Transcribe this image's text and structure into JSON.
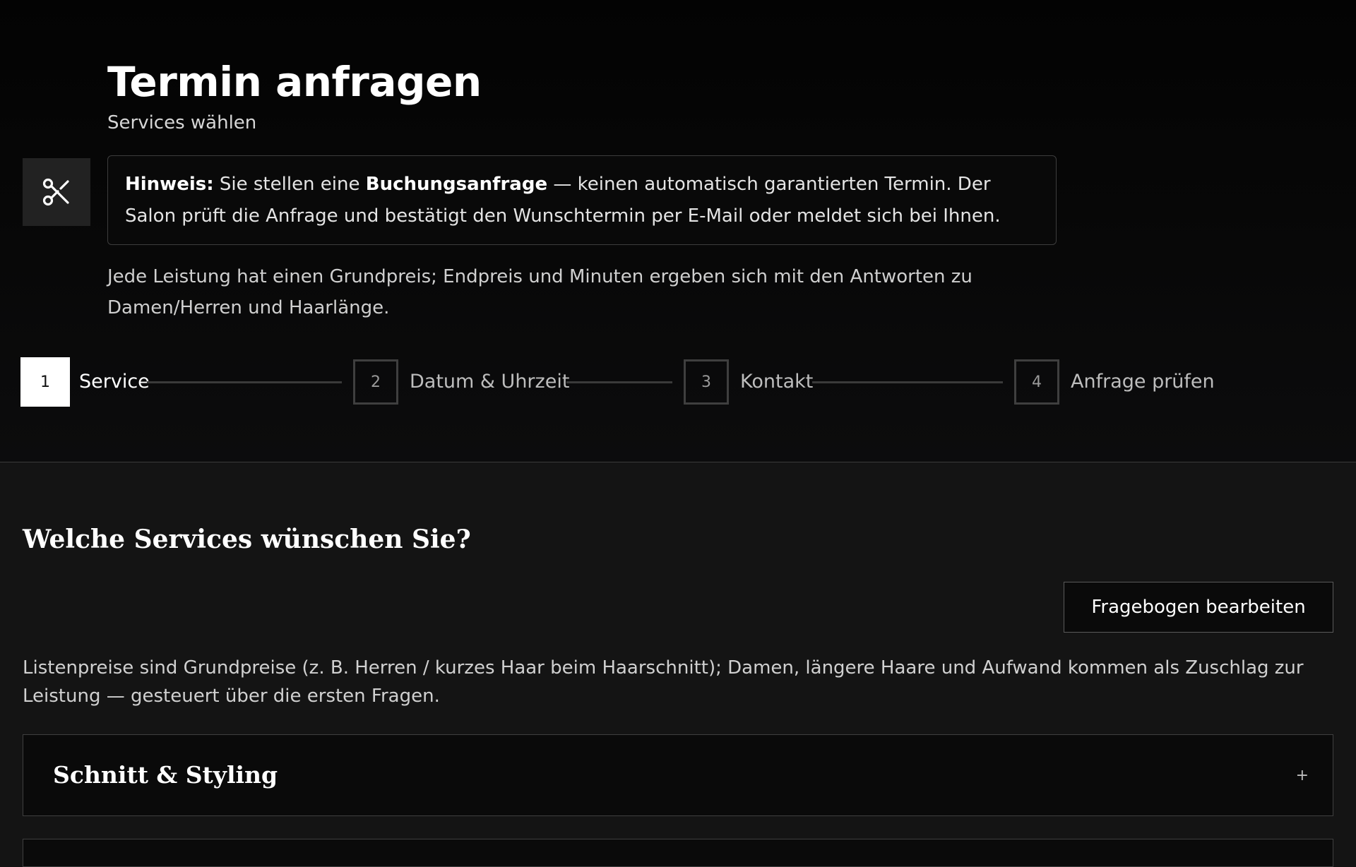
{
  "header": {
    "title": "Termin anfragen",
    "subtitle": "Services wählen"
  },
  "logo": {
    "icon": "scissors-icon"
  },
  "notice": {
    "label": "Hinweis:",
    "text_before": "Sie stellen eine",
    "emphasis": "Buchungsanfrage",
    "text_after": "— keinen automatisch garantierten Termin. Der Salon prüft die Anfrage und bestätigt den Wunschtermin per E-Mail oder meldet sich bei Ihnen."
  },
  "intro": "Jede Leistung hat einen Grundpreis; Endpreis und Minuten ergeben sich mit den Antworten zu Damen/Herren und Haarlänge.",
  "steps": [
    {
      "number": "1",
      "label": "Service",
      "active": true
    },
    {
      "number": "2",
      "label": "Datum & Uhrzeit",
      "active": false
    },
    {
      "number": "3",
      "label": "Kontakt",
      "active": false
    },
    {
      "number": "4",
      "label": "Anfrage prüfen",
      "active": false
    }
  ],
  "services": {
    "title": "Welche Services wünschen Sie?",
    "edit_button": "Fragebogen bearbeiten",
    "price_note": "Listenpreise sind Grundpreise (z. B. Herren / kurzes Haar beim Haarschnitt); Damen, längere Haare und Aufwand kommen als Zuschlag zur Leistung — gesteuert über die ersten Fragen.",
    "categories": [
      {
        "title": "Schnitt & Styling",
        "toggle": "+"
      }
    ]
  },
  "colors": {
    "background": "#141414",
    "hero_background": "#050505",
    "accent": "#ffffff",
    "border": "#3f3f3f"
  }
}
